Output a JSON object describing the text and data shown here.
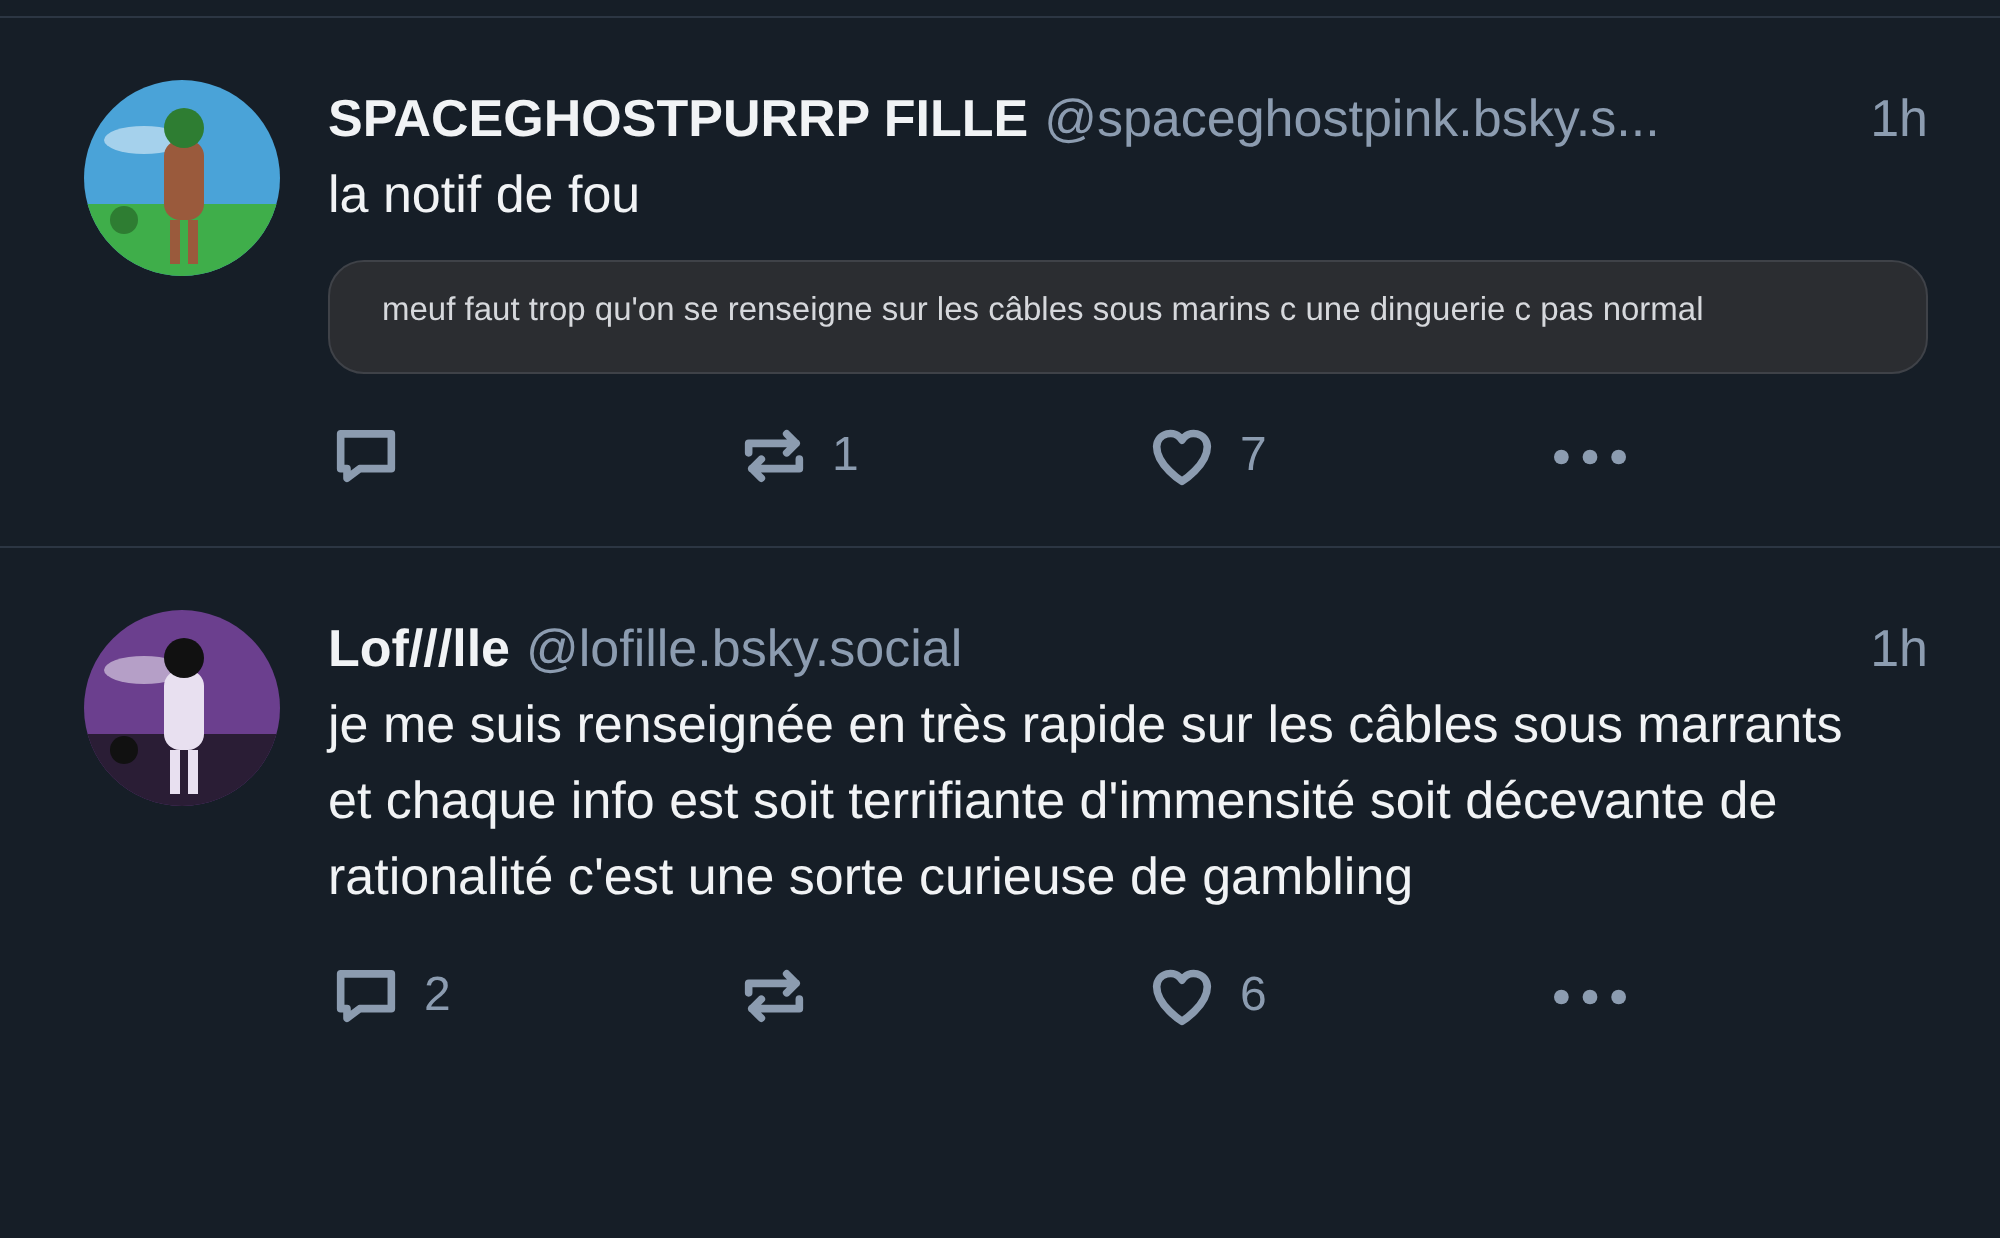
{
  "posts": [
    {
      "display_name": "SPACEGHOSTPURRP FILLE",
      "handle": "@spaceghostpink.bsky.s...",
      "time": "1h",
      "text": "la notif de fou",
      "embed": {
        "kind": "screenshot",
        "text": "meuf faut trop qu'on se renseigne sur les câbles sous marins c une dinguerie c pas normal"
      },
      "reposts": "1",
      "likes": "7"
    },
    {
      "display_name": "Lof///lle",
      "handle": "@lofille.bsky.social",
      "time": "1h",
      "text": "je me suis renseignée en très rapide sur les câbles sous marrants et chaque info est soit terrifiante d'immensité soit décevante de rationalité c'est une sorte curieuse de gambling",
      "replies": "2",
      "likes": "6"
    }
  ]
}
